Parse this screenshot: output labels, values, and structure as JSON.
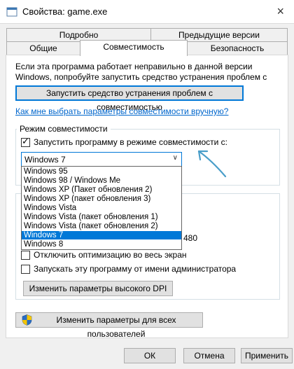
{
  "window": {
    "title": "Свойства: game.exe",
    "close_label": "×"
  },
  "tabs": {
    "row1": [
      {
        "label": "Подробно"
      },
      {
        "label": "Предыдущие версии"
      }
    ],
    "row2": [
      {
        "label": "Общие"
      },
      {
        "label": "Совместимость",
        "active": true
      },
      {
        "label": "Безопасность"
      }
    ]
  },
  "compat": {
    "info_text": "Если эта программа работает неправильно в данной версии Windows, попробуйте запустить средство устранения проблем с совместимостью.",
    "troubleshoot_button": "Запустить средство устранения проблем с совместимостью",
    "manual_link": "Как мне выбрать параметры совместимости вручную?",
    "mode_group_title": "Режим совместимости",
    "mode_checkbox_label": "Запустить программу в режиме совместимости с:",
    "mode_checked": true,
    "selected_os": "Windows 7",
    "os_options": [
      "Windows 95",
      "Windows 98 / Windows Me",
      "Windows XP (Пакет обновления 2)",
      "Windows XP (пакет обновления 3)",
      "Windows Vista",
      "Windows Vista (пакет обновления 1)",
      "Windows Vista (пакет обновления 2)",
      "Windows 7",
      "Windows 8"
    ],
    "selected_index": 7,
    "resolution_partial": "480",
    "disable_fullscreen_label": "Отключить оптимизацию во весь экран",
    "run_as_admin_label": "Запускать эту программу от имени администратора",
    "dpi_button": "Изменить параметры высокого DPI",
    "all_users_button": "Изменить параметры для всех пользователей"
  },
  "footer": {
    "ok": "ОК",
    "cancel": "Отмена",
    "apply": "Применить"
  },
  "colors": {
    "accent": "#0078d7",
    "link": "#0066cc",
    "annotation_arrow": "#4a9ec9"
  }
}
